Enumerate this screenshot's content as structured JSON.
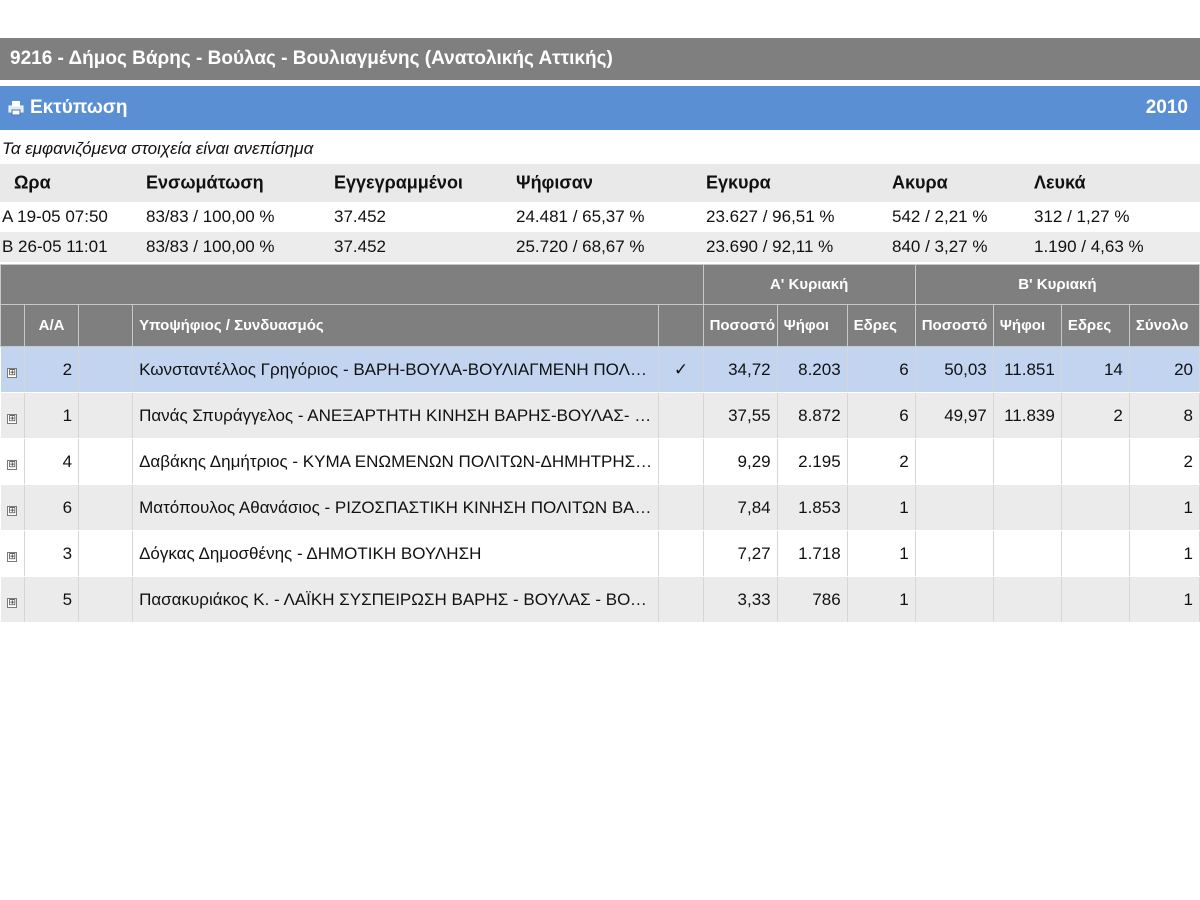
{
  "header": {
    "title": "9216 - Δήμος Βάρης - Βούλας - Βουλιαγμένης (Ανατολικής Αττικής)"
  },
  "toolbar": {
    "print_label": "Εκτύπωση",
    "year": "2010",
    "print_icon": "printer-icon"
  },
  "notice": "Τα εμφανιζόμενα στοιχεία είναι ανεπίσημα",
  "stats": {
    "headers": [
      "Ωρα",
      "Ενσωμάτωση",
      "Εγγεγραμμένοι",
      "Ψήφισαν",
      "Εγκυρα",
      "Ακυρα",
      "Λευκά"
    ],
    "rows": [
      [
        "A 19-05 07:50",
        "83/83 / 100,00 %",
        "37.452",
        "24.481 / 65,37 %",
        "23.627 / 96,51 %",
        "542 / 2,21 %",
        "312 / 1,27 %"
      ],
      [
        "B 26-05 11:01",
        "83/83 / 100,00 %",
        "37.452",
        "25.720 / 68,67 %",
        "23.690 / 92,11 %",
        "840 / 3,27 %",
        "1.190 / 4,63 %"
      ]
    ]
  },
  "results": {
    "group_headers": {
      "first": "Α' Κυριακή",
      "second": "Β' Κυριακή"
    },
    "columns": {
      "aa": "Α/Α",
      "candidate": "Υποψήφιος / Συνδυασμός",
      "pct1": "Ποσοστό",
      "votes1": "Ψήφοι",
      "seats1": "Εδρες",
      "pct2": "Ποσοστό",
      "votes2": "Ψήφοι",
      "seats2": "Εδρες",
      "total": "Σύνολο"
    },
    "expand_glyph": "⊞",
    "rows": [
      {
        "aa": "2",
        "name": "Κωνσταντέλλος Γρηγόριος - ΒΑΡΗ-ΒΟΥΛΑ-ΒΟΥΛΙΑΓΜΕΝΗ ΠΟΛΗ ΓΙΑ ΝΑ ΖΕΙΣ",
        "check": "✓",
        "pct1": "34,72",
        "votes1": "8.203",
        "seats1": "6",
        "pct2": "50,03",
        "votes2": "11.851",
        "seats2": "14",
        "total": "20"
      },
      {
        "aa": "1",
        "name": "Πανάς Σπυράγγελος - ΑΝΕΞΑΡΤΗΤΗ ΚΙΝΗΣΗ ΒΑΡΗΣ-ΒΟΥΛΑΣ- ΒΟΥΛΙΑΓΜΕΝΗΣ",
        "check": "",
        "pct1": "37,55",
        "votes1": "8.872",
        "seats1": "6",
        "pct2": "49,97",
        "votes2": "11.839",
        "seats2": "2",
        "total": "8"
      },
      {
        "aa": "4",
        "name": "Δαβάκης Δημήτριος - ΚΥΜΑ ΕΝΩΜΕΝΩΝ ΠΟΛΙΤΩΝ-ΔΗΜΗΤΡΗΣ ΔΑΒΑΚΗΣ",
        "check": "",
        "pct1": "9,29",
        "votes1": "2.195",
        "seats1": "2",
        "pct2": "",
        "votes2": "",
        "seats2": "",
        "total": "2"
      },
      {
        "aa": "6",
        "name": "Ματόπουλος Αθανάσιος - ΡΙΖΟΣΠΑΣΤΙΚΗ ΚΙΝΗΣΗ ΠΟΛΙΤΩΝ ΒΑΡΗΣ-ΒΟΥΛΑΣ-Β...",
        "check": "",
        "pct1": "7,84",
        "votes1": "1.853",
        "seats1": "1",
        "pct2": "",
        "votes2": "",
        "seats2": "",
        "total": "1"
      },
      {
        "aa": "3",
        "name": "Δόγκας Δημοσθένης - ΔΗΜΟΤΙΚΗ ΒΟΥΛΗΣΗ",
        "check": "",
        "pct1": "7,27",
        "votes1": "1.718",
        "seats1": "1",
        "pct2": "",
        "votes2": "",
        "seats2": "",
        "total": "1"
      },
      {
        "aa": "5",
        "name": "Πασακυριάκος Κ. - ΛΑΪΚΗ ΣΥΣΠΕΙΡΩΣΗ ΒΑΡΗΣ - ΒΟΥΛΑΣ - ΒΟΥΛΙΑΓΜΕΝΗΣ",
        "check": "",
        "pct1": "3,33",
        "votes1": "786",
        "seats1": "1",
        "pct2": "",
        "votes2": "",
        "seats2": "",
        "total": "1"
      }
    ]
  },
  "colors": {
    "title_bar": "#7f7f7f",
    "toolbar": "#5b8fd4",
    "selected_row": "#c3d4f0",
    "table_header": "#7f7f7f"
  }
}
